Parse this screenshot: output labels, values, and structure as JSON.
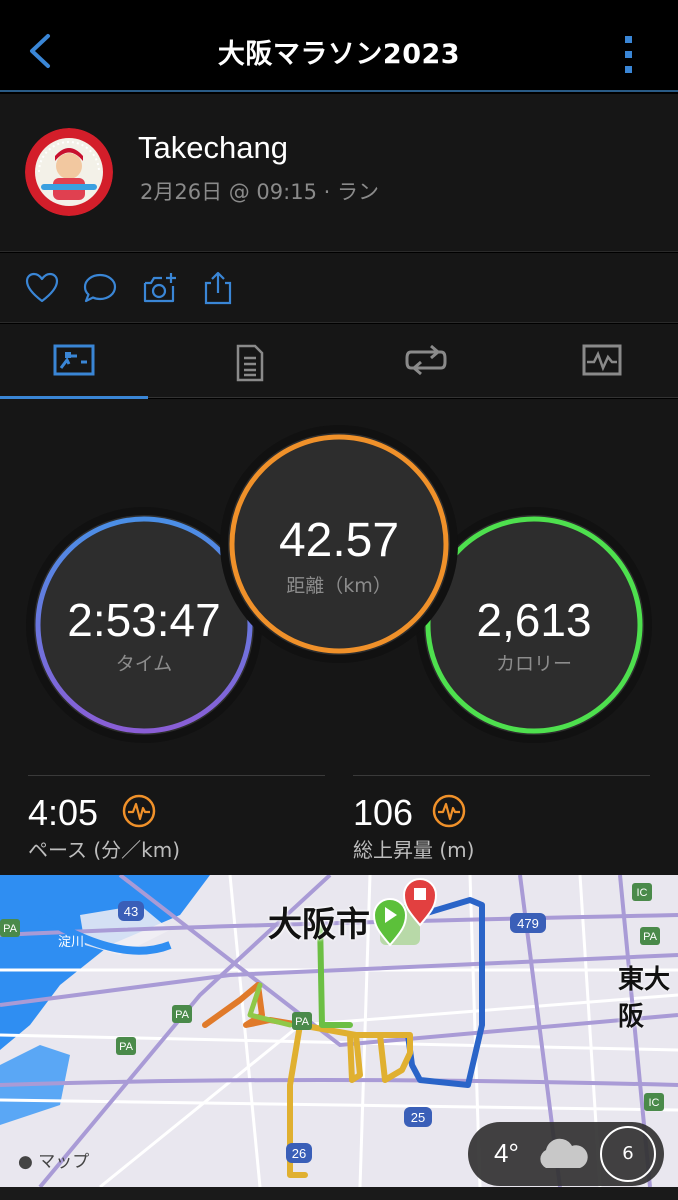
{
  "nav": {
    "title": "大阪マラソン2023",
    "back_icon": "chevron-left-icon",
    "more_icon": "more-vertical-icon"
  },
  "header": {
    "user_name": "Takechang",
    "meta": "2月26日 @ 09:15 · ラン"
  },
  "actions": [
    "heart-icon",
    "comment-icon",
    "add-photo-icon",
    "share-icon"
  ],
  "tabs": [
    {
      "name": "overview",
      "icon": "overview-icon",
      "active": true
    },
    {
      "name": "stats",
      "icon": "document-icon",
      "active": false
    },
    {
      "name": "laps",
      "icon": "laps-icon",
      "active": false
    },
    {
      "name": "graphs",
      "icon": "chart-icon",
      "active": false
    }
  ],
  "stats": {
    "time": {
      "value": "2:53:47",
      "label": "タイム"
    },
    "distance": {
      "value": "42.57",
      "label": "距離（km）"
    },
    "calories": {
      "value": "2,613",
      "label": "カロリー"
    }
  },
  "metrics": {
    "pace": {
      "value": "4:05",
      "label": "ペース (分／km)"
    },
    "ascent": {
      "value": "106",
      "label": "総上昇量 (m)"
    }
  },
  "map": {
    "city_label": "大阪市",
    "city2_label": "東大阪",
    "river_label": "淀川",
    "attribution": "マップ",
    "route_numbers": [
      "43",
      "479",
      "25",
      "26"
    ],
    "pa_label": "PA",
    "ic_label": "IC"
  },
  "weather": {
    "temp": "4°",
    "aqi": "6"
  },
  "colors": {
    "accent": "#3a86d6",
    "distance": "#f0912a",
    "calories": "#4ee04e",
    "time_start": "#4a8fe6",
    "time_end": "#8a5ed6"
  }
}
